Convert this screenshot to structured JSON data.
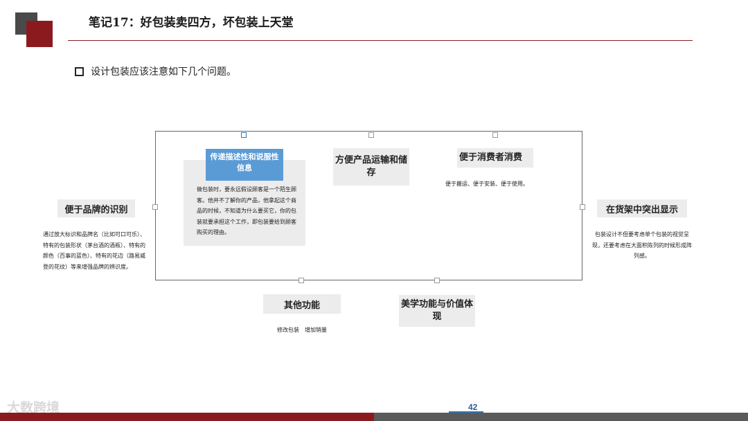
{
  "header": {
    "title": "笔记17：好包装卖四方，坏包装上天堂",
    "bullet": "设计包装应该注意如下几个问题。"
  },
  "items": {
    "convey": {
      "label": "传递描述性和说服性信息",
      "text": "做包装时，要永远假设顾客是一个陌生顾客。他并不了解你的产品，他拿起这个商品的时候，不知道为什么要买它，你的包装就要承担这个工作，即包装要给到顾客购买的理由。"
    },
    "transport": {
      "label": "方便产品运输和储存"
    },
    "consumer": {
      "label": "便于消费者消费",
      "text": "便于搬运、便于安装、便于使用。"
    },
    "brand": {
      "label": "便于品牌的识别",
      "text": "通过放大标识和品牌名（比如可口可乐）、特有的包装形状（茅台酒的酒瓶）、特有的颜色（百事的蓝色）、特有的花边（路易威登的花纹）等来增强品牌的辨识度。"
    },
    "shelf": {
      "label": "在货架中突出显示",
      "text": "包装设计不但要考虑单个包装的视觉呈现，还要考虑在大面积陈列的时候形成阵列感。"
    },
    "other": {
      "label": "其他功能",
      "text": "修改包装　增加销量"
    },
    "aesthetic": {
      "label": "美学功能与价值体现"
    }
  },
  "footer": {
    "page_number": "42",
    "watermark": "大数跨境"
  },
  "colors": {
    "accent_red": "#8b1a1f",
    "accent_blue": "#5b9bd5",
    "dark_gray": "#4a4a4a"
  }
}
